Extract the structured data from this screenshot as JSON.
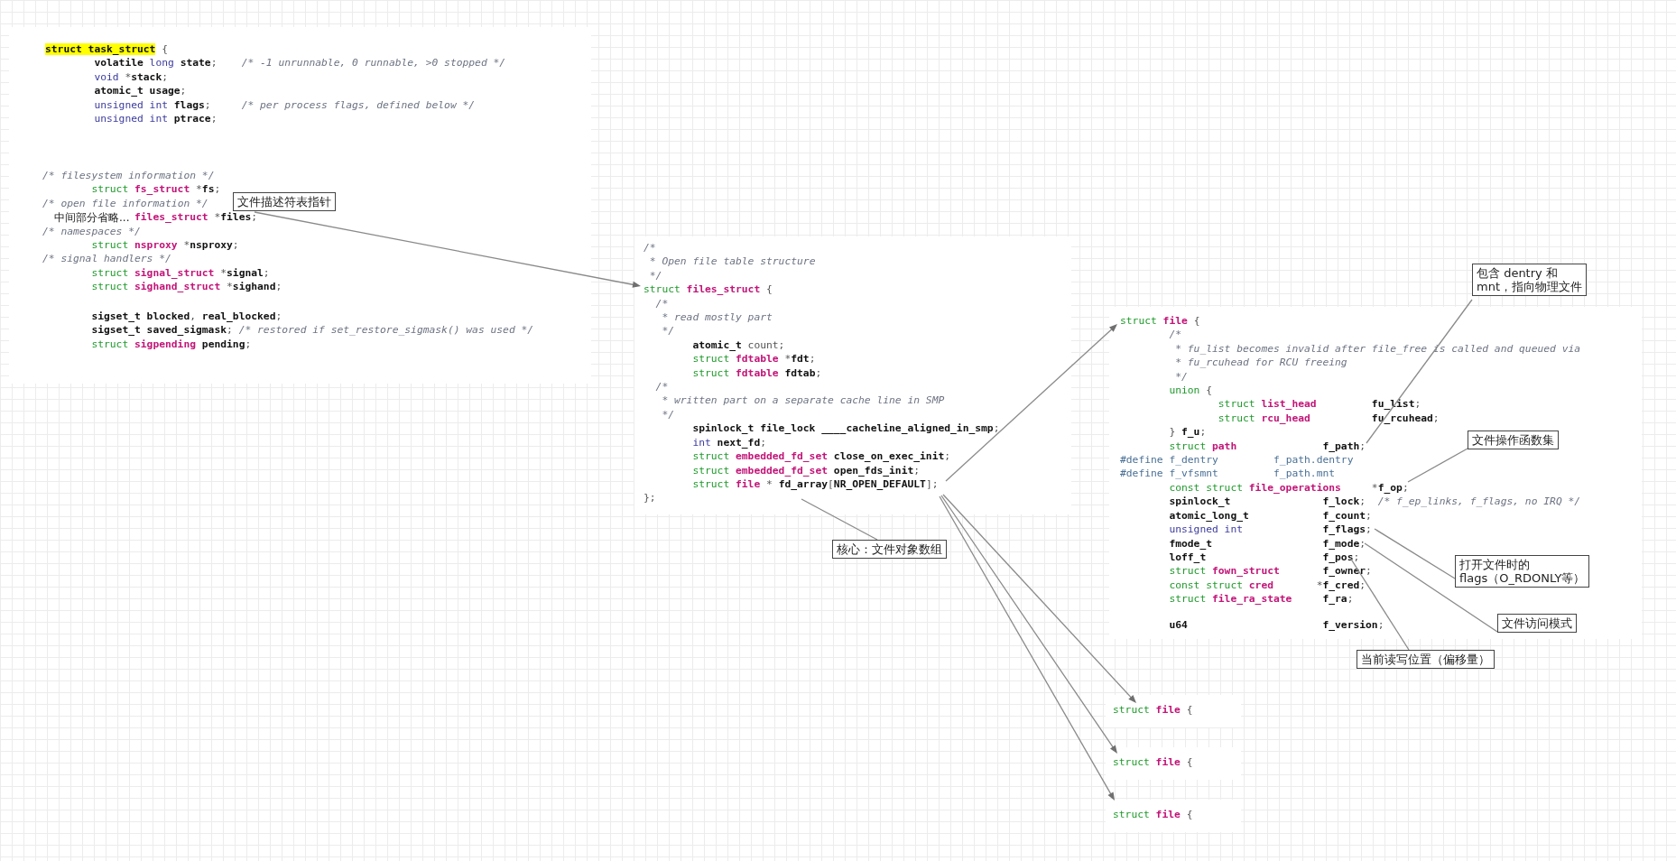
{
  "blocks": [
    {
      "lines": [
        {
          "kind": "i0",
          "tokens": [
            {
              "text": "struct task_struct",
              "kind": "hl"
            },
            {
              "text": " {",
              "kind": "p"
            }
          ]
        },
        {
          "kind": "i8",
          "tokens": [
            {
              "text": "volatile ",
              "kind": "id"
            },
            {
              "text": "long ",
              "kind": "bi"
            },
            {
              "text": "state",
              "kind": "id"
            },
            {
              "text": ";    ",
              "kind": "p"
            },
            {
              "text": "/* -1 unrunnable, 0 runnable, >0 stopped */",
              "kind": "c"
            }
          ]
        },
        {
          "kind": "i8",
          "tokens": [
            {
              "text": "void ",
              "kind": "bi"
            },
            {
              "text": "*",
              "kind": "p"
            },
            {
              "text": "stack",
              "kind": "id"
            },
            {
              "text": ";",
              "kind": "p"
            }
          ]
        },
        {
          "kind": "i8",
          "tokens": [
            {
              "text": "atomic_t usage",
              "kind": "id"
            },
            {
              "text": ";",
              "kind": "p"
            }
          ]
        },
        {
          "kind": "i8",
          "tokens": [
            {
              "text": "unsigned int ",
              "kind": "bi"
            },
            {
              "text": "flags",
              "kind": "id"
            },
            {
              "text": ";     ",
              "kind": "p"
            },
            {
              "text": "/* per process flags, defined below */",
              "kind": "c"
            }
          ]
        },
        {
          "kind": "i8",
          "tokens": [
            {
              "text": "unsigned int ",
              "kind": "bi"
            },
            {
              "text": "ptrace",
              "kind": "id"
            },
            {
              "text": ";",
              "kind": "p"
            }
          ]
        }
      ]
    },
    {
      "lines": [
        {
          "kind": "i0",
          "tokens": [
            {
              "text": "/* filesystem information */",
              "kind": "c"
            }
          ]
        },
        {
          "kind": "i8",
          "tokens": [
            {
              "text": "struct ",
              "kind": "kw"
            },
            {
              "text": "fs_struct ",
              "kind": "ty"
            },
            {
              "text": "*",
              "kind": "p"
            },
            {
              "text": "fs",
              "kind": "id"
            },
            {
              "text": ";",
              "kind": "p"
            }
          ]
        },
        {
          "kind": "i0",
          "tokens": [
            {
              "text": "/* open file information */",
              "kind": "c"
            }
          ]
        },
        {
          "kind": "i15",
          "tokens": [
            {
              "text": "files_struct ",
              "kind": "ty"
            },
            {
              "text": "*",
              "kind": "p"
            },
            {
              "text": "files",
              "kind": "id"
            },
            {
              "text": ";",
              "kind": "p"
            }
          ]
        },
        {
          "kind": "i0",
          "tokens": [
            {
              "text": "/* namespaces */",
              "kind": "c"
            }
          ]
        },
        {
          "kind": "i8",
          "tokens": [
            {
              "text": "struct ",
              "kind": "kw"
            },
            {
              "text": "nsproxy ",
              "kind": "ty"
            },
            {
              "text": "*",
              "kind": "p"
            },
            {
              "text": "nsproxy",
              "kind": "id"
            },
            {
              "text": ";",
              "kind": "p"
            }
          ]
        },
        {
          "kind": "i0",
          "tokens": [
            {
              "text": "/* signal handlers */",
              "kind": "c"
            }
          ]
        },
        {
          "kind": "i8",
          "tokens": [
            {
              "text": "struct ",
              "kind": "kw"
            },
            {
              "text": "signal_struct ",
              "kind": "ty"
            },
            {
              "text": "*",
              "kind": "p"
            },
            {
              "text": "signal",
              "kind": "id"
            },
            {
              "text": ";",
              "kind": "p"
            }
          ]
        },
        {
          "kind": "i8",
          "tokens": [
            {
              "text": "struct ",
              "kind": "kw"
            },
            {
              "text": "sighand_struct ",
              "kind": "ty"
            },
            {
              "text": "*",
              "kind": "p"
            },
            {
              "text": "sighand",
              "kind": "id"
            },
            {
              "text": ";",
              "kind": "p"
            }
          ]
        }
      ]
    },
    {
      "lines": [
        {
          "kind": "i8",
          "tokens": [
            {
              "text": "sigset_t blocked",
              "kind": "id"
            },
            {
              "text": ", ",
              "kind": "p"
            },
            {
              "text": "real_blocked",
              "kind": "id"
            },
            {
              "text": ";",
              "kind": "p"
            }
          ]
        },
        {
          "kind": "i8",
          "tokens": [
            {
              "text": "sigset_t saved_sigmask",
              "kind": "id"
            },
            {
              "text": "; ",
              "kind": "p"
            },
            {
              "text": "/* restored if set_restore_sigmask() was used */",
              "kind": "c"
            }
          ]
        },
        {
          "kind": "i8",
          "tokens": [
            {
              "text": "struct ",
              "kind": "kw"
            },
            {
              "text": "sigpending ",
              "kind": "ty"
            },
            {
              "text": "pending",
              "kind": "id"
            },
            {
              "text": ";",
              "kind": "p"
            }
          ]
        }
      ]
    },
    {
      "lines": [
        {
          "kind": "i0",
          "tokens": [
            {
              "text": "/*",
              "kind": "c"
            }
          ]
        },
        {
          "kind": "i1",
          "tokens": [
            {
              "text": "* Open file table structure",
              "kind": "c"
            }
          ]
        },
        {
          "kind": "i1",
          "tokens": [
            {
              "text": "*/",
              "kind": "c"
            }
          ]
        },
        {
          "kind": "i0",
          "tokens": [
            {
              "text": "struct ",
              "kind": "kw"
            },
            {
              "text": "files_struct",
              "kind": "ty"
            },
            {
              "text": " {",
              "kind": "p"
            }
          ]
        },
        {
          "kind": "i2",
          "tokens": [
            {
              "text": "/*",
              "kind": "c"
            }
          ]
        },
        {
          "kind": "i3",
          "tokens": [
            {
              "text": "* read mostly part",
              "kind": "c"
            }
          ]
        },
        {
          "kind": "i3",
          "tokens": [
            {
              "text": "*/",
              "kind": "c"
            }
          ]
        },
        {
          "kind": "i8",
          "tokens": [
            {
              "text": "atomic_t",
              "kind": "id"
            },
            {
              "text": " count;",
              "kind": "p"
            }
          ]
        },
        {
          "kind": "i8",
          "tokens": [
            {
              "text": "struct ",
              "kind": "kw"
            },
            {
              "text": "fdtable ",
              "kind": "ty"
            },
            {
              "text": "*",
              "kind": "p"
            },
            {
              "text": "fdt",
              "kind": "id"
            },
            {
              "text": ";",
              "kind": "p"
            }
          ]
        },
        {
          "kind": "i8",
          "tokens": [
            {
              "text": "struct ",
              "kind": "kw"
            },
            {
              "text": "fdtable ",
              "kind": "ty"
            },
            {
              "text": "fdtab",
              "kind": "id"
            },
            {
              "text": ";",
              "kind": "p"
            }
          ]
        },
        {
          "kind": "i2",
          "tokens": [
            {
              "text": "/*",
              "kind": "c"
            }
          ]
        },
        {
          "kind": "i3",
          "tokens": [
            {
              "text": "* written part on a separate cache line in SMP",
              "kind": "c"
            }
          ]
        },
        {
          "kind": "i3",
          "tokens": [
            {
              "text": "*/",
              "kind": "c"
            }
          ]
        },
        {
          "kind": "i8",
          "tokens": [
            {
              "text": "spinlock_t file_lock ____cacheline_aligned_in_smp",
              "kind": "id"
            },
            {
              "text": ";",
              "kind": "p"
            }
          ]
        },
        {
          "kind": "i8",
          "tokens": [
            {
              "text": "int ",
              "kind": "bi"
            },
            {
              "text": "next_fd",
              "kind": "id"
            },
            {
              "text": ";",
              "kind": "p"
            }
          ]
        },
        {
          "kind": "i8",
          "tokens": [
            {
              "text": "struct ",
              "kind": "kw"
            },
            {
              "text": "embedded_fd_set ",
              "kind": "ty"
            },
            {
              "text": "close_on_exec_init",
              "kind": "id"
            },
            {
              "text": ";",
              "kind": "p"
            }
          ]
        },
        {
          "kind": "i8",
          "tokens": [
            {
              "text": "struct ",
              "kind": "kw"
            },
            {
              "text": "embedded_fd_set ",
              "kind": "ty"
            },
            {
              "text": "open_fds_init",
              "kind": "id"
            },
            {
              "text": ";",
              "kind": "p"
            }
          ]
        },
        {
          "kind": "i8",
          "tokens": [
            {
              "text": "struct ",
              "kind": "kw"
            },
            {
              "text": "file",
              "kind": "ty"
            },
            {
              "text": " * ",
              "kind": "p"
            },
            {
              "text": "fd_array",
              "kind": "id"
            },
            {
              "text": "[",
              "kind": "p"
            },
            {
              "text": "NR_OPEN_DEFAULT",
              "kind": "id"
            },
            {
              "text": "];",
              "kind": "p"
            }
          ]
        },
        {
          "kind": "i0",
          "tokens": [
            {
              "text": "};",
              "kind": "p"
            }
          ]
        }
      ]
    },
    {
      "lines": [
        {
          "kind": "i0",
          "tokens": [
            {
              "text": "struct ",
              "kind": "kw"
            },
            {
              "text": "file",
              "kind": "ty"
            },
            {
              "text": " {",
              "kind": "p"
            }
          ]
        },
        {
          "kind": "i8",
          "tokens": [
            {
              "text": "/*",
              "kind": "c"
            }
          ]
        },
        {
          "kind": "i9",
          "tokens": [
            {
              "text": "* fu_list becomes invalid after file_free is called and queued via",
              "kind": "c"
            }
          ]
        },
        {
          "kind": "i9",
          "tokens": [
            {
              "text": "* fu_rcuhead for RCU freeing",
              "kind": "c"
            }
          ]
        },
        {
          "kind": "i9",
          "tokens": [
            {
              "text": "*/",
              "kind": "c"
            }
          ]
        },
        {
          "kind": "i8",
          "tokens": [
            {
              "text": "union",
              "kind": "kw"
            },
            {
              "text": " {",
              "kind": "p"
            }
          ]
        },
        {
          "kind": "i16",
          "tokens": [
            {
              "text": "struct ",
              "kind": "kw"
            },
            {
              "text": "list_head         ",
              "kind": "ty"
            },
            {
              "text": "fu_list",
              "kind": "id"
            },
            {
              "text": ";",
              "kind": "p"
            }
          ]
        },
        {
          "kind": "i16",
          "tokens": [
            {
              "text": "struct ",
              "kind": "kw"
            },
            {
              "text": "rcu_head          ",
              "kind": "ty"
            },
            {
              "text": "fu_rcuhead",
              "kind": "id"
            },
            {
              "text": ";",
              "kind": "p"
            }
          ]
        },
        {
          "kind": "i8",
          "tokens": [
            {
              "text": "} ",
              "kind": "p"
            },
            {
              "text": "f_u",
              "kind": "id"
            },
            {
              "text": ";",
              "kind": "p"
            }
          ]
        },
        {
          "kind": "i8",
          "tokens": [
            {
              "text": "struct ",
              "kind": "kw"
            },
            {
              "text": "path              ",
              "kind": "ty"
            },
            {
              "text": "f_path",
              "kind": "id"
            },
            {
              "text": ";",
              "kind": "p"
            }
          ]
        },
        {
          "kind": "i0",
          "tokens": [
            {
              "text": "#define f_dentry         f_path.dentry",
              "kind": "df"
            }
          ]
        },
        {
          "kind": "i0",
          "tokens": [
            {
              "text": "#define f_vfsmnt         f_path.mnt",
              "kind": "df"
            }
          ]
        },
        {
          "kind": "i8",
          "tokens": [
            {
              "text": "const struct ",
              "kind": "kw"
            },
            {
              "text": "file_operations     ",
              "kind": "ty"
            },
            {
              "text": "*",
              "kind": "p"
            },
            {
              "text": "f_op",
              "kind": "id"
            },
            {
              "text": ";",
              "kind": "p"
            }
          ]
        },
        {
          "kind": "i8",
          "tokens": [
            {
              "text": "spinlock_t               f_lock",
              "kind": "id"
            },
            {
              "text": ";  ",
              "kind": "p"
            },
            {
              "text": "/* f_ep_links, f_flags, no IRQ */",
              "kind": "c"
            }
          ]
        },
        {
          "kind": "i8",
          "tokens": [
            {
              "text": "atomic_long_t            f_count",
              "kind": "id"
            },
            {
              "text": ";",
              "kind": "p"
            }
          ]
        },
        {
          "kind": "i8",
          "tokens": [
            {
              "text": "unsigned int             ",
              "kind": "bi"
            },
            {
              "text": "f_flags",
              "kind": "id"
            },
            {
              "text": ";",
              "kind": "p"
            }
          ]
        },
        {
          "kind": "i8",
          "tokens": [
            {
              "text": "fmode_t                  f_mode",
              "kind": "id"
            },
            {
              "text": ";",
              "kind": "p"
            }
          ]
        },
        {
          "kind": "i8",
          "tokens": [
            {
              "text": "loff_t                   f_pos",
              "kind": "id"
            },
            {
              "text": ";",
              "kind": "p"
            }
          ]
        },
        {
          "kind": "i8",
          "tokens": [
            {
              "text": "struct ",
              "kind": "kw"
            },
            {
              "text": "fown_struct       ",
              "kind": "ty"
            },
            {
              "text": "f_owner",
              "kind": "id"
            },
            {
              "text": ";",
              "kind": "p"
            }
          ]
        },
        {
          "kind": "i8",
          "tokens": [
            {
              "text": "const struct ",
              "kind": "kw"
            },
            {
              "text": "cred       ",
              "kind": "ty"
            },
            {
              "text": "*",
              "kind": "p"
            },
            {
              "text": "f_cred",
              "kind": "id"
            },
            {
              "text": ";",
              "kind": "p"
            }
          ]
        },
        {
          "kind": "i8",
          "tokens": [
            {
              "text": "struct ",
              "kind": "kw"
            },
            {
              "text": "file_ra_state     ",
              "kind": "ty"
            },
            {
              "text": "f_ra",
              "kind": "id"
            },
            {
              "text": ";",
              "kind": "p"
            }
          ]
        }
      ]
    },
    {
      "lines": [
        {
          "kind": "i8",
          "tokens": [
            {
              "text": "u64                      f_version",
              "kind": "id"
            },
            {
              "text": ";",
              "kind": "p"
            }
          ]
        }
      ]
    },
    {
      "lines": [
        {
          "kind": "i0",
          "tokens": [
            {
              "text": "struct ",
              "kind": "kw"
            },
            {
              "text": "file",
              "kind": "ty"
            },
            {
              "text": " {",
              "kind": "p"
            }
          ]
        }
      ]
    },
    {
      "lines": [
        {
          "kind": "i0",
          "tokens": [
            {
              "text": "struct ",
              "kind": "kw"
            },
            {
              "text": "file",
              "kind": "ty"
            },
            {
              "text": " {",
              "kind": "p"
            }
          ]
        }
      ]
    },
    {
      "lines": [
        {
          "kind": "i0",
          "tokens": [
            {
              "text": "struct ",
              "kind": "kw"
            },
            {
              "text": "file",
              "kind": "ty"
            },
            {
              "text": " {",
              "kind": "p"
            }
          ]
        }
      ]
    }
  ],
  "annotations": [
    {
      "kind": "boxed",
      "lines": [
        "文件描述符表指针"
      ]
    },
    {
      "kind": "plain",
      "lines": [
        "中间部分省略..."
      ]
    },
    {
      "kind": "boxed",
      "lines": [
        "核心：文件对象数组"
      ]
    },
    {
      "kind": "boxed",
      "lines": [
        "包含 dentry 和",
        "mnt，指向物理文件"
      ]
    },
    {
      "kind": "boxed",
      "lines": [
        "文件操作函数集"
      ]
    },
    {
      "kind": "boxed",
      "lines": [
        "打开文件时的",
        "flags（O_RDONLY等）"
      ]
    },
    {
      "kind": "boxed",
      "lines": [
        "文件访问模式"
      ]
    },
    {
      "kind": "boxed",
      "lines": [
        "当前读写位置（偏移量）"
      ]
    }
  ]
}
